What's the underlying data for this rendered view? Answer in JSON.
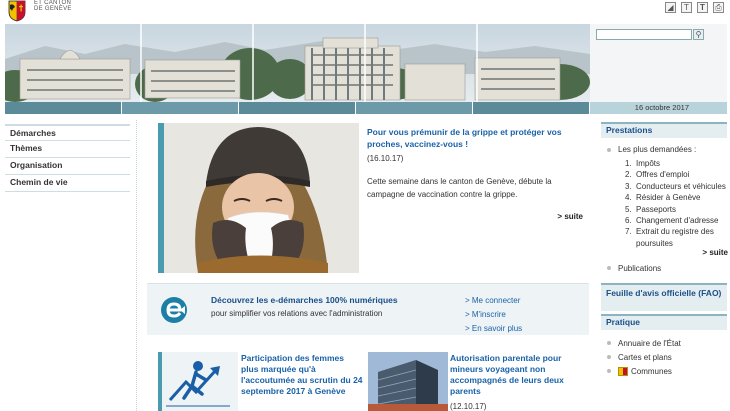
{
  "header": {
    "logo_text_line1": "ET CANTON",
    "logo_text_line2": "DE GENÈVE",
    "icons": [
      "contrast-icon",
      "text-smaller-icon",
      "text-larger-icon",
      "print-icon"
    ],
    "icon_glyphs": [
      "◢",
      "T",
      "T",
      "⎙"
    ]
  },
  "search": {
    "value": "",
    "button_glyph": "🔍"
  },
  "date": "16 octobre 2017",
  "nav": {
    "items": [
      "Démarches",
      "Thèmes",
      "Organisation",
      "Chemin de vie"
    ]
  },
  "featured": {
    "title": "Pour vous prémunir de la grippe et protéger vos proches, vaccinez-vous !",
    "date": "(16.10.17)",
    "text": "Cette semaine dans le canton de Genève, débute la campagne de vaccination contre la grippe.",
    "more": "> suite"
  },
  "edemarches": {
    "title": "Découvrez les e-démarches 100% numériques",
    "subtitle": "pour simplifier vos relations avec l'administration",
    "links": [
      "> Me connecter",
      "> M'inscrire",
      "> En savoir plus"
    ]
  },
  "news": [
    {
      "title": "Participation des femmes plus marquée qu'à l'accoutumée au scrutin du 24 septembre 2017 à Genève",
      "date": ""
    },
    {
      "title": "Autorisation parentale pour mineurs voyageant non accompagnés de leurs deux parents",
      "date": "(12.10.17)"
    }
  ],
  "prestations": {
    "heading": "Prestations",
    "subheading": "Les plus demandées :",
    "items": [
      {
        "num": "1.",
        "label": "Impôts"
      },
      {
        "num": "2.",
        "label": "Offres d'emploi"
      },
      {
        "num": "3.",
        "label": "Conducteurs et véhicules"
      },
      {
        "num": "4.",
        "label": "Résider à Genève"
      },
      {
        "num": "5.",
        "label": "Passeports"
      },
      {
        "num": "6.",
        "label": "Changement d'adresse"
      },
      {
        "num": "7.",
        "label": "Extrait du registre des poursuites"
      }
    ],
    "more": "> suite",
    "publications": "Publications"
  },
  "fao": {
    "heading": "Feuille d'avis officielle (FAO)"
  },
  "pratique": {
    "heading": "Pratique",
    "links": [
      "Annuaire de l'État",
      "Cartes et plans",
      "Communes"
    ]
  },
  "colors": {
    "accent_blue": "#1a62a8",
    "stripe_teal": "#5b8a99",
    "sidebar_header_bg": "#e4eef1",
    "sidebar_header_border": "#8bb3c0"
  }
}
